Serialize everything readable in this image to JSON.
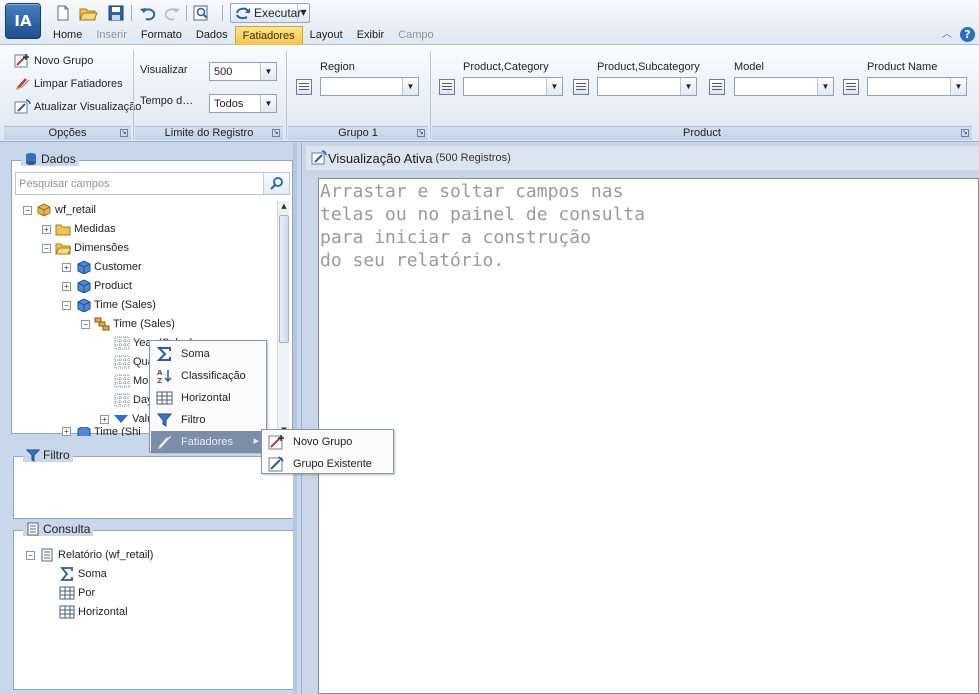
{
  "app": {
    "logo_text": "IA"
  },
  "quick_access": {
    "run_label": "Executar"
  },
  "menu": [
    {
      "label": "Home",
      "state": "normal"
    },
    {
      "label": "Inserir",
      "state": "disabled"
    },
    {
      "label": "Formato",
      "state": "normal"
    },
    {
      "label": "Dados",
      "state": "normal"
    },
    {
      "label": "Fatiadores",
      "state": "active"
    },
    {
      "label": "Layout",
      "state": "normal"
    },
    {
      "label": "Exibir",
      "state": "normal"
    },
    {
      "label": "Campo",
      "state": "disabled"
    }
  ],
  "ribbon": {
    "opcoes": {
      "title": "Opções",
      "buttons": [
        "Novo Grupo",
        "Limpar Fatiadores",
        "Atualizar Visualização"
      ]
    },
    "limite": {
      "title": "Limite do Registro",
      "visualizar_label": "Visualizar",
      "visualizar_value": "500",
      "tempo_label": "Tempo d…",
      "tempo_value": "Todos"
    },
    "grupo1": {
      "title": "Grupo 1",
      "field_label": "Region"
    },
    "product": {
      "title": "Product",
      "fields": [
        "Product,Category",
        "Product,Subcategory",
        "Model",
        "Product Name"
      ]
    }
  },
  "left_panel": {
    "dados_title": "Dados",
    "search_placeholder": "Pesquisar campos",
    "tree": [
      {
        "label": "wf_retail",
        "icon": "cube-icon",
        "toggle": "−"
      },
      {
        "label": "Medidas",
        "icon": "folder-icon",
        "toggle": "+"
      },
      {
        "label": "Dimensões",
        "icon": "folder-open-icon",
        "toggle": "−"
      },
      {
        "label": "Customer",
        "icon": "dimension-icon",
        "toggle": "+"
      },
      {
        "label": "Product",
        "icon": "dimension-icon",
        "toggle": "+"
      },
      {
        "label": "Time (Sales)",
        "icon": "dimension-icon",
        "toggle": "−"
      },
      {
        "label": "Time (Sales)",
        "icon": "hierarchy-icon",
        "toggle": "−"
      },
      {
        "label": "Year (Sales)",
        "icon": "grid-icon",
        "toggle": ""
      },
      {
        "label": "Qua",
        "icon": "grid-icon",
        "toggle": ""
      },
      {
        "label": "Mon",
        "icon": "grid-icon",
        "toggle": ""
      },
      {
        "label": "Day",
        "icon": "grid-icon",
        "toggle": ""
      },
      {
        "label": "Valu",
        "icon": "filter-blue-icon",
        "toggle": "+"
      },
      {
        "label": "Time (Shi",
        "icon": "dimension-icon",
        "toggle": "+"
      }
    ],
    "filtro_title": "Filtro",
    "consulta_title": "Consulta",
    "consulta_tree": [
      {
        "label": "Relatório (wf_retail)",
        "icon": "report-icon",
        "toggle": "−"
      },
      {
        "label": "Soma",
        "icon": "sigma-icon",
        "toggle": ""
      },
      {
        "label": "Por",
        "icon": "grid-icon",
        "toggle": ""
      },
      {
        "label": "Horizontal",
        "icon": "grid-icon",
        "toggle": ""
      }
    ]
  },
  "main": {
    "title": "Visualização Ativa",
    "subtitle": "(500 Registros)",
    "placeholder": "Arrastar e soltar campos nas\ntelas ou no painel de consulta\npara iniciar a construção\ndo seu relatório."
  },
  "context_menu": {
    "items": [
      {
        "label": "Soma",
        "icon": "sigma-icon"
      },
      {
        "label": "Classificação",
        "icon": "sort-az-icon"
      },
      {
        "label": "Horizontal",
        "icon": "grid-icon"
      },
      {
        "label": "Filtro",
        "icon": "filter-icon"
      },
      {
        "label": "Fatiadores",
        "icon": "slicer-icon",
        "highlighted": true,
        "submenu": true
      }
    ],
    "submenu": [
      {
        "label": "Novo Grupo",
        "icon": "new-group-icon"
      },
      {
        "label": "Grupo Existente",
        "icon": "existing-group-icon"
      }
    ]
  },
  "colors": {
    "accent_active_tab": "#f5c24a",
    "context_highlight": "#7b8da8",
    "panel_bg": "#c8d7ea"
  }
}
